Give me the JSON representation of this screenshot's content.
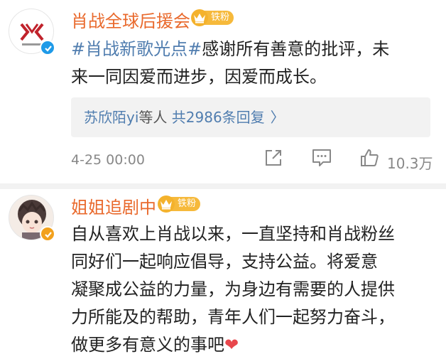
{
  "comments": [
    {
      "username": "肖战全球后援会",
      "badge": "铁粉",
      "hashtag": "#肖战新歌光点#",
      "text_line1": "感谢所有善意的批评，未",
      "text_line2": "来一同因爱而进步，因爱而成长。",
      "replies": {
        "name": "苏欣陌yi",
        "mid": "等人",
        "count": "共2986条回复",
        "chevron": "〉"
      },
      "time": "4-25 00:00",
      "like_count": "10.3万"
    },
    {
      "username": "姐姐追剧中",
      "badge": "铁粉",
      "lines": [
        "自从喜欢上肖战以来，一直坚持和肖战粉丝",
        "同好们一起响应倡导，支持公益。将爱意",
        "凝聚成公益的力量，为身边有需要的人提供",
        "力所能及的帮助，青年人们一起努力奋斗，",
        "做更多有意义的事吧"
      ],
      "emoji": "❤"
    }
  ],
  "icons": {
    "share": "share-icon",
    "comment": "comment-icon",
    "like": "like-icon",
    "verify_blue": "verified-blue-icon",
    "verify_orange": "verified-orange-icon",
    "crown": "crown-icon"
  },
  "colors": {
    "username": "#e9692c",
    "link": "#507daf",
    "badge": "#f6b93b",
    "verify_blue": "#1f9ae8",
    "verify_orange": "#f2a11d"
  }
}
